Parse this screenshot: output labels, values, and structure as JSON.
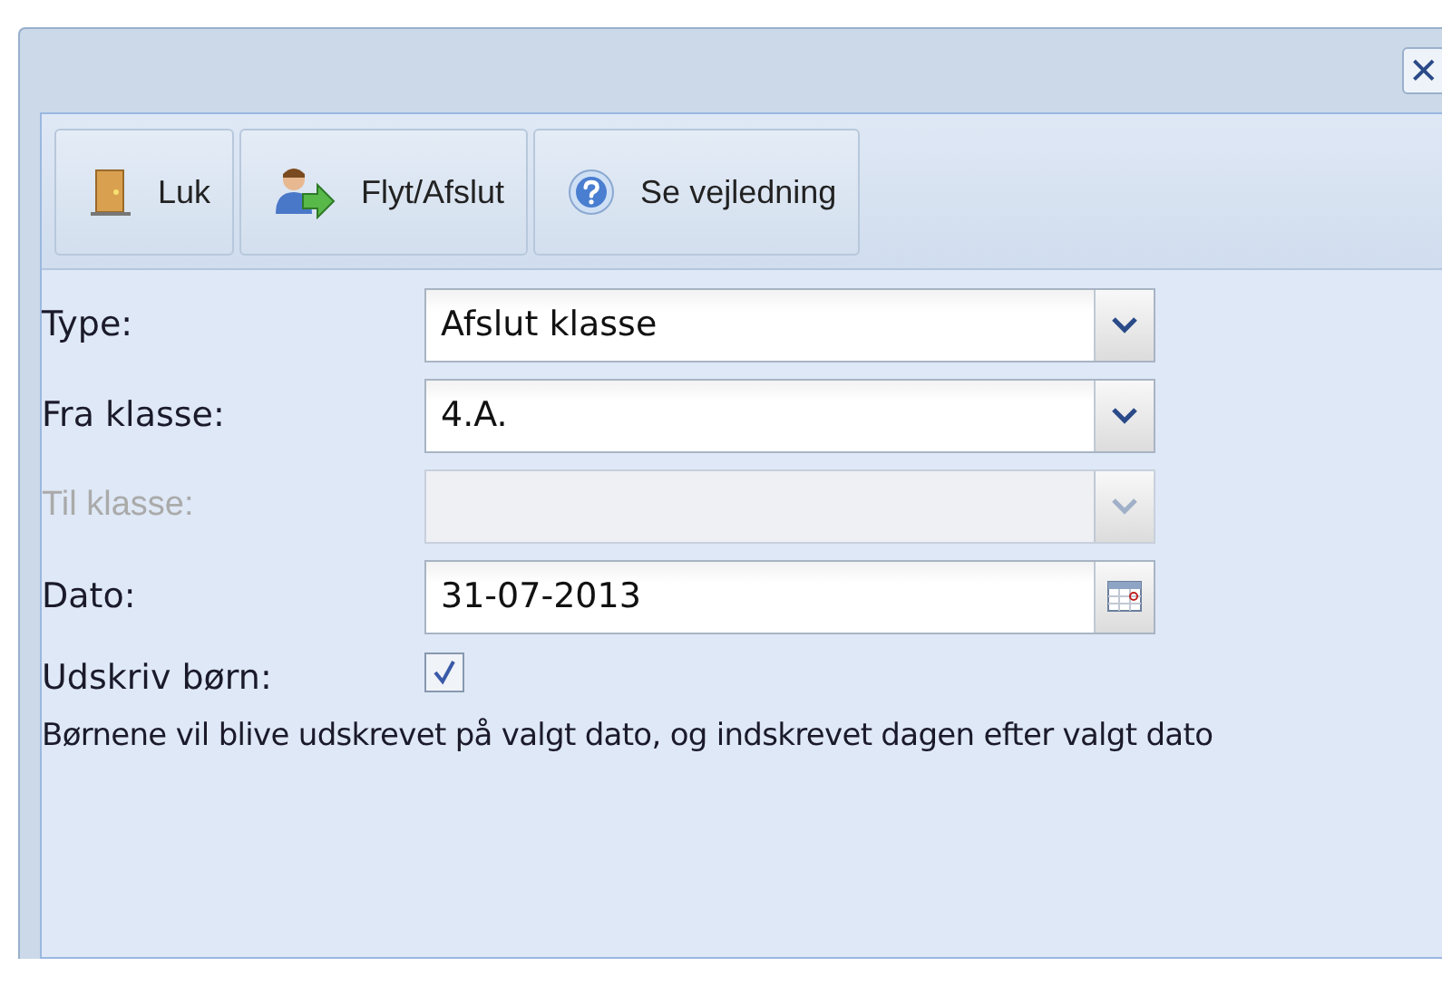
{
  "window": {
    "close_label": "✕"
  },
  "toolbar": [
    {
      "label": "Luk"
    },
    {
      "label": "Flyt/Afslut"
    },
    {
      "label": "Se vejledning"
    }
  ],
  "fields": [
    {
      "kind": "combo",
      "label": "Type:",
      "value": "Afslut klasse",
      "disabled": false
    },
    {
      "kind": "combo",
      "label": "Fra klasse:",
      "value": "4.A.",
      "disabled": false
    },
    {
      "kind": "combo",
      "label": "Til klasse:",
      "disabled": true
    },
    {
      "kind": "date",
      "label": "Dato:",
      "value": "31-07-2013",
      "disabled": false
    },
    {
      "kind": "checkbox",
      "label": "Udskriv børn:",
      "checked": true,
      "disabled": false
    }
  ],
  "note": "Børnene vil blive udskrevet på valgt dato, og indskrevet dagen efter valgt dato"
}
